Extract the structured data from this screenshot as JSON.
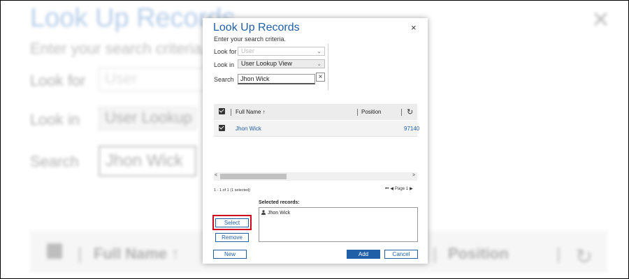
{
  "background": {
    "title": "Look Up Records",
    "subtitle": "Enter your search criteria.",
    "look_for_label": "Look for",
    "look_for_value": "User",
    "look_in_label": "Look in",
    "look_in_value": "User Lookup View",
    "search_label": "Search",
    "search_value": "Jhon Wick",
    "col_full_name": "Full Name ↑",
    "col_position": "Position",
    "sep": "|"
  },
  "dialog": {
    "title": "Look Up Records",
    "subtitle": "Enter your search criteria.",
    "close": "×",
    "look_for_label": "Look for",
    "look_for_placeholder": "User",
    "look_in_label": "Look in",
    "look_in_value": "User Lookup View",
    "search_label": "Search",
    "search_value": "Jhon Wick",
    "clear": "×"
  },
  "grid": {
    "columns": [
      "Full Name ↑",
      "Position"
    ],
    "rows": [
      {
        "full_name": "Jhon Wick",
        "number": "97140"
      }
    ],
    "status": "1 - 1 of 1 (1 selected)",
    "page_label": "Page 1"
  },
  "selected": {
    "label": "Selected records:",
    "items": [
      "Jhon Wick"
    ]
  },
  "buttons": {
    "select": "Select",
    "remove": "Remove",
    "new": "New",
    "add": "Add",
    "cancel": "Cancel"
  },
  "colors": {
    "accent": "#1f5fa8",
    "highlight": "#d0021b"
  }
}
